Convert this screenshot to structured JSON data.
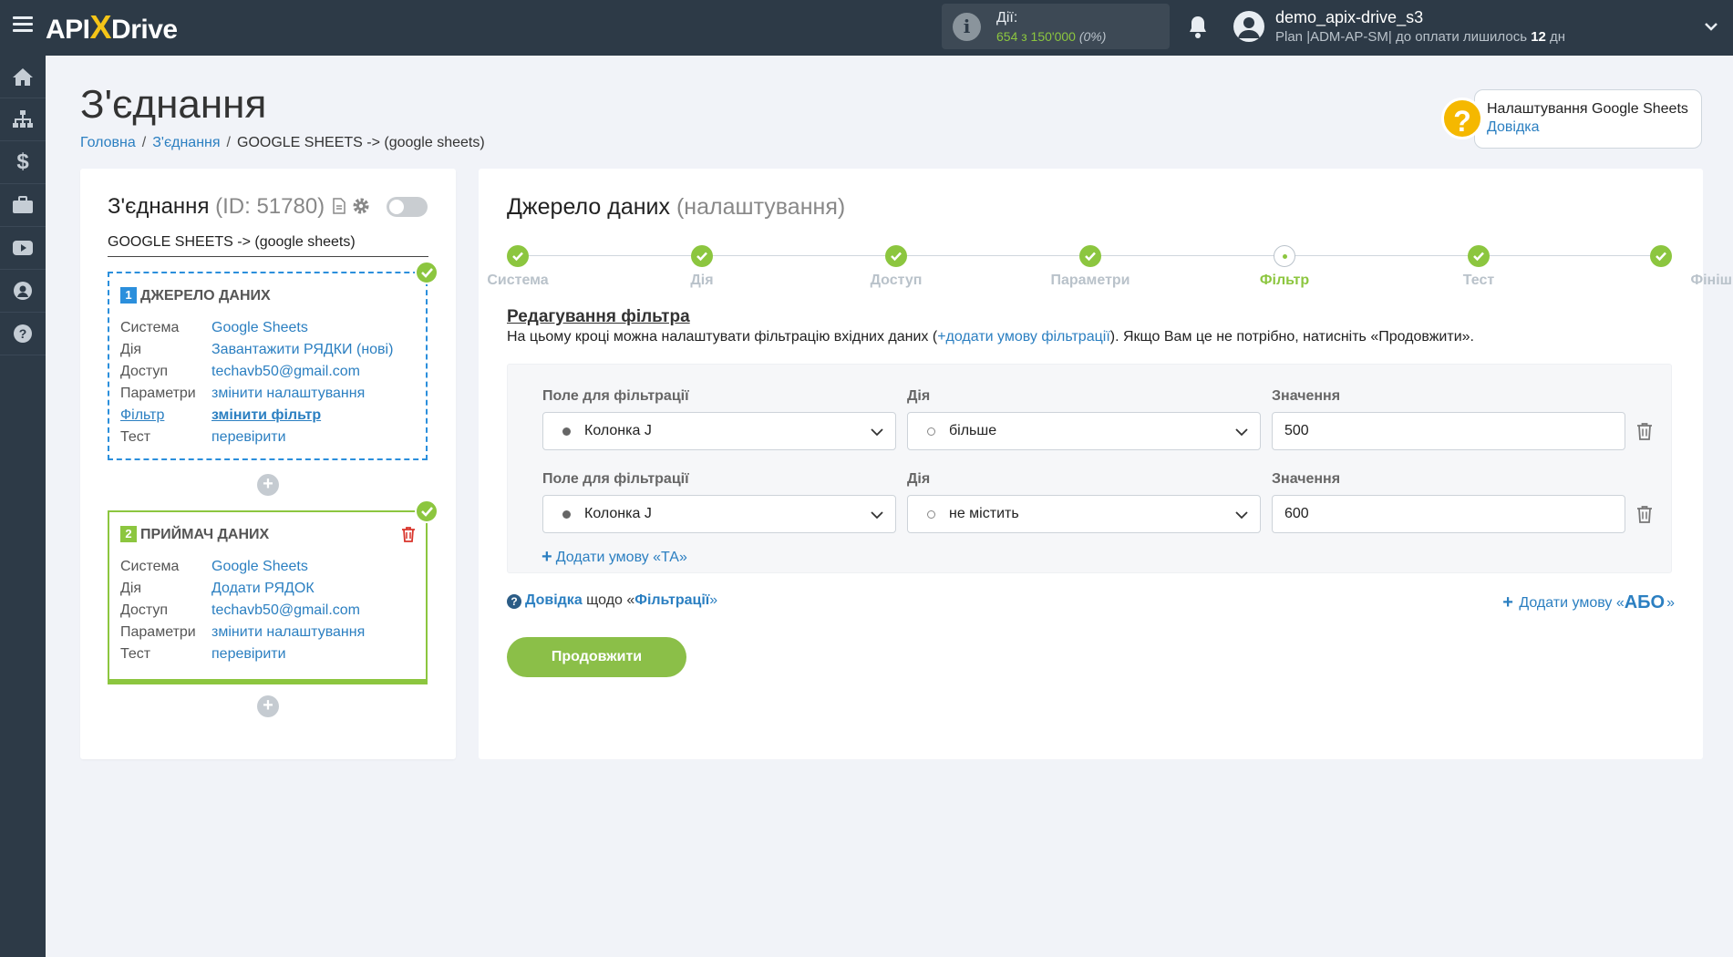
{
  "topbar": {
    "logo": {
      "part1": "API",
      "x": "X",
      "part2": "Drive"
    },
    "actions": {
      "label": "Дії:",
      "count": "654 з 150'000",
      "percent": "(0%)"
    },
    "user": {
      "name": "demo_apix-drive_s3",
      "plan": "Plan |ADM-AP-SM| до оплати лишилось",
      "days_num": "12",
      "days_unit": "дн"
    }
  },
  "sidebar": {
    "items": [
      "home-icon",
      "sitemap-icon",
      "dollar-icon",
      "briefcase-icon",
      "youtube-icon",
      "user-icon",
      "help-icon"
    ]
  },
  "header": {
    "title": "З'єднання",
    "breadcrumb": [
      "Головна",
      "З'єднання",
      "GOOGLE SHEETS -> (google sheets)"
    ],
    "help": {
      "title": "Налаштування Google Sheets",
      "link": "Довідка"
    }
  },
  "connection": {
    "title": "З'єднання",
    "id": "(ID: 51780)",
    "subtitle": "GOOGLE SHEETS -> (google sheets)",
    "source": {
      "num": "1",
      "title": "ДЖЕРЕЛО ДАНИХ",
      "rows": [
        {
          "k": "Система",
          "v": "Google Sheets"
        },
        {
          "k": "Дія",
          "v": "Завантажити РЯДКИ (нові)"
        },
        {
          "k": "Доступ",
          "v": "techavb50@gmail.com"
        },
        {
          "k": "Параметри",
          "v": "змінити налаштування"
        },
        {
          "k": "Фільтр",
          "v": "змінити фільтр"
        },
        {
          "k": "Тест",
          "v": "перевірити"
        }
      ]
    },
    "receiver": {
      "num": "2",
      "title": "ПРИЙМАЧ ДАНИХ",
      "rows": [
        {
          "k": "Система",
          "v": "Google Sheets"
        },
        {
          "k": "Дія",
          "v": "Додати РЯДОК"
        },
        {
          "k": "Доступ",
          "v": "techavb50@gmail.com"
        },
        {
          "k": "Параметри",
          "v": "змінити налаштування"
        },
        {
          "k": "Тест",
          "v": "перевірити"
        }
      ]
    },
    "plus": "+"
  },
  "main": {
    "title": "Джерело даних",
    "title_sub": "(налаштування)",
    "steps": [
      "Система",
      "Дія",
      "Доступ",
      "Параметри",
      "Фільтр",
      "Тест",
      "Фініш"
    ],
    "active_step": "Фільтр",
    "section_title": "Редагування фільтра",
    "desc_before": "На цьому кроці можна налаштувати фільтрацію вхідних даних (",
    "desc_link": "+додати умову фільтрації",
    "desc_after": "). Якщо Вам це не потрібно, натисніть «Продовжити».",
    "filters": [
      {
        "field_label": "Поле для фільтрації",
        "field": "Колонка J",
        "action_label": "Дія",
        "action": "більше",
        "value_label": "Значення",
        "value": "500"
      },
      {
        "field_label": "Поле для фільтрації",
        "field": "Колонка J",
        "action_label": "Дія",
        "action": "не містить",
        "value_label": "Значення",
        "value": "600"
      }
    ],
    "add_and": "Додати умову «ТА»",
    "help_bold": "Довідка",
    "help_mid": "щодо «",
    "help_bold2": "Фільтрації",
    "help_end": "»",
    "add_or_prefix": "Додати умову «",
    "add_or_bold": "АБО",
    "add_or_suffix": "»",
    "continue": "Продовжити"
  },
  "colors": {
    "accent_green": "#8cc63f",
    "link_blue": "#2b7fc1",
    "topbar": "#2d3a47",
    "help_yellow": "#f5b800"
  }
}
